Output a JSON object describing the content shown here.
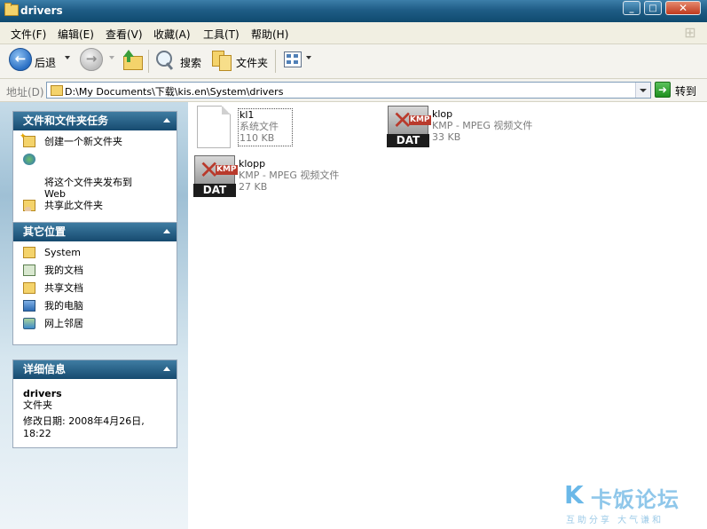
{
  "window": {
    "title": "drivers"
  },
  "menu": [
    "文件(F)",
    "编辑(E)",
    "查看(V)",
    "收藏(A)",
    "工具(T)",
    "帮助(H)"
  ],
  "toolbar": {
    "back_label": "后退",
    "search_label": "搜索",
    "folders_label": "文件夹"
  },
  "address": {
    "label": "地址(D)",
    "path": "D:\\My Documents\\下载\\kis.en\\System\\drivers",
    "go_label": "转到"
  },
  "tasks": {
    "title": "文件和文件夹任务",
    "items": [
      "创建一个新文件夹",
      "将这个文件夹发布到\nWeb",
      "共享此文件夹"
    ]
  },
  "places": {
    "title": "其它位置",
    "items": [
      "System",
      "我的文档",
      "共享文档",
      "我的电脑",
      "网上邻居"
    ]
  },
  "details": {
    "title": "详细信息",
    "name": "drivers",
    "type": "文件夹",
    "modified": "修改日期: 2008年4月26日,\n18:22"
  },
  "files": [
    {
      "name": "kl1",
      "type": "系统文件",
      "size": "110 KB",
      "icon": "blank-file-icon",
      "selected": true
    },
    {
      "name": "klop",
      "type": "KMP - MPEG 视频文件",
      "size": "33 KB",
      "icon": "kmp-dat-icon",
      "badge": "DAT",
      "logo": "KMP"
    },
    {
      "name": "klopp",
      "type": "KMP - MPEG 视频文件",
      "size": "27 KB",
      "icon": "kmp-dat-icon",
      "badge": "DAT",
      "logo": "KMP"
    }
  ],
  "watermark": {
    "logo": "K",
    "name": "卡饭论坛",
    "tagline": "互助分享  大气谦和"
  },
  "colors": {
    "titlebar": "#1f5d86",
    "panel_header": "#164a6f",
    "pane_bg": "#9fc0d5"
  }
}
